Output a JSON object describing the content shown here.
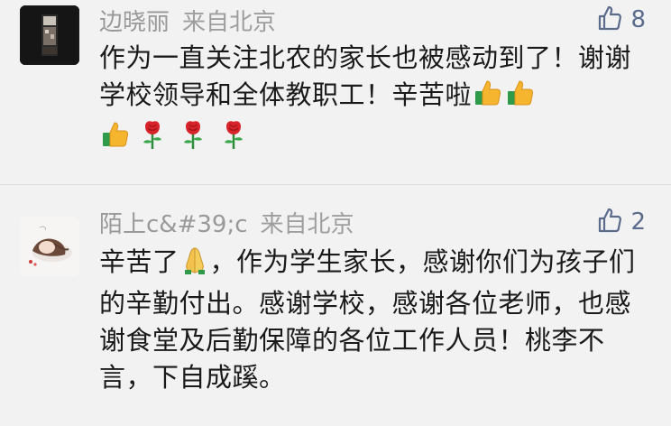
{
  "comments": [
    {
      "username": "边晓丽",
      "location": "来自北京",
      "likes": "8",
      "text": "作为一直关注北农的家长也被感动到了！谢谢学校领导和全体教职工！辛苦啦",
      "emoji": [
        "thumbs-up",
        "thumbs-up",
        "thumbs-up",
        "rose",
        "rose",
        "rose"
      ]
    },
    {
      "username": "陌上c&#39;c",
      "location": "来自北京",
      "likes": "2",
      "text_before_emoji": "辛苦了",
      "emoji": [
        "folded-hands"
      ],
      "text_after_emoji": "，作为学生家长，感谢你们为孩子们的辛勤付出。感谢学校，感谢各位老师，也感谢食堂及后勤保障的各位工作人员！桃李不言，下自成蹊。"
    }
  ],
  "colors": {
    "background": "#f2f2f2",
    "meta_text": "#9e9e9e",
    "body_text": "#1a1a1a",
    "like_icon": "#5a6b8c"
  }
}
